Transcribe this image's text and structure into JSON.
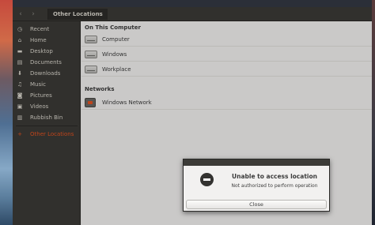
{
  "header": {
    "back_icon": "‹",
    "forward_icon": "›",
    "location_label": "Other Locations",
    "next_icon": "›"
  },
  "sidebar": {
    "items": [
      {
        "label": "Recent",
        "icon": "◷"
      },
      {
        "label": "Home",
        "icon": "⌂"
      },
      {
        "label": "Desktop",
        "icon": "▬"
      },
      {
        "label": "Documents",
        "icon": "▤"
      },
      {
        "label": "Downloads",
        "icon": "⬇"
      },
      {
        "label": "Music",
        "icon": "♫"
      },
      {
        "label": "Pictures",
        "icon": "◙"
      },
      {
        "label": "Videos",
        "icon": "▣"
      },
      {
        "label": "Rubbish Bin",
        "icon": "▥"
      },
      {
        "label": "Other Locations",
        "icon": "+"
      }
    ],
    "active_color": "#e95420"
  },
  "main": {
    "on_this_computer_title": "On This Computer",
    "computer_items": [
      "Computer",
      "Windows",
      "Workplace"
    ],
    "networks_title": "Networks",
    "network_items": [
      "Windows Network"
    ]
  },
  "dialog": {
    "title": "Unable to access location",
    "message": "Not authorized to perform operation",
    "close_label": "Close"
  }
}
